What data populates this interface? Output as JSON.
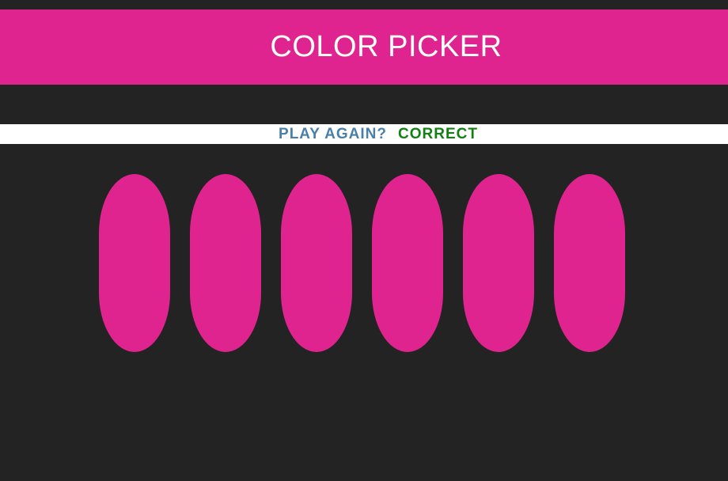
{
  "header": {
    "title": "COLOR PICKER",
    "background": "#e0248f"
  },
  "stripe": {
    "play_again_label": "PLAY AGAIN?",
    "play_again_color": "#4a7fa8",
    "message": "CORRECT",
    "message_color": "#138013"
  },
  "squares": {
    "colors": [
      "#e0248f",
      "#e0248f",
      "#e0248f",
      "#e0248f",
      "#e0248f",
      "#e0248f"
    ]
  },
  "theme": {
    "background": "#232323",
    "stripe_background": "#ffffff"
  }
}
